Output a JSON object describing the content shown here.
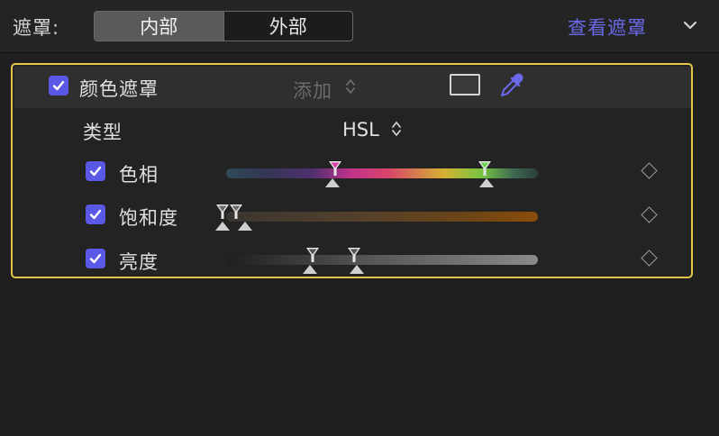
{
  "header": {
    "mask_label": "遮罩:",
    "segment_inner": "内部",
    "segment_outer": "外部",
    "view_mask": "查看遮罩"
  },
  "color_mask": {
    "title": "颜色遮罩",
    "enabled": true,
    "blend_mode": "添加",
    "type_label": "类型",
    "type_value": "HSL"
  },
  "channels": [
    {
      "label": "色相",
      "enabled": true
    },
    {
      "label": "饱和度",
      "enabled": true
    },
    {
      "label": "亮度",
      "enabled": true
    }
  ],
  "colors": {
    "accent": "#5b58e6",
    "panel_border": "#e3c54a",
    "link": "#6a68e8"
  },
  "icons": [
    "chevron-down-icon",
    "checkbox-checked-icon",
    "updown-arrows-icon",
    "mask-preview-icon",
    "eyedropper-icon",
    "keyframe-diamond-icon"
  ]
}
